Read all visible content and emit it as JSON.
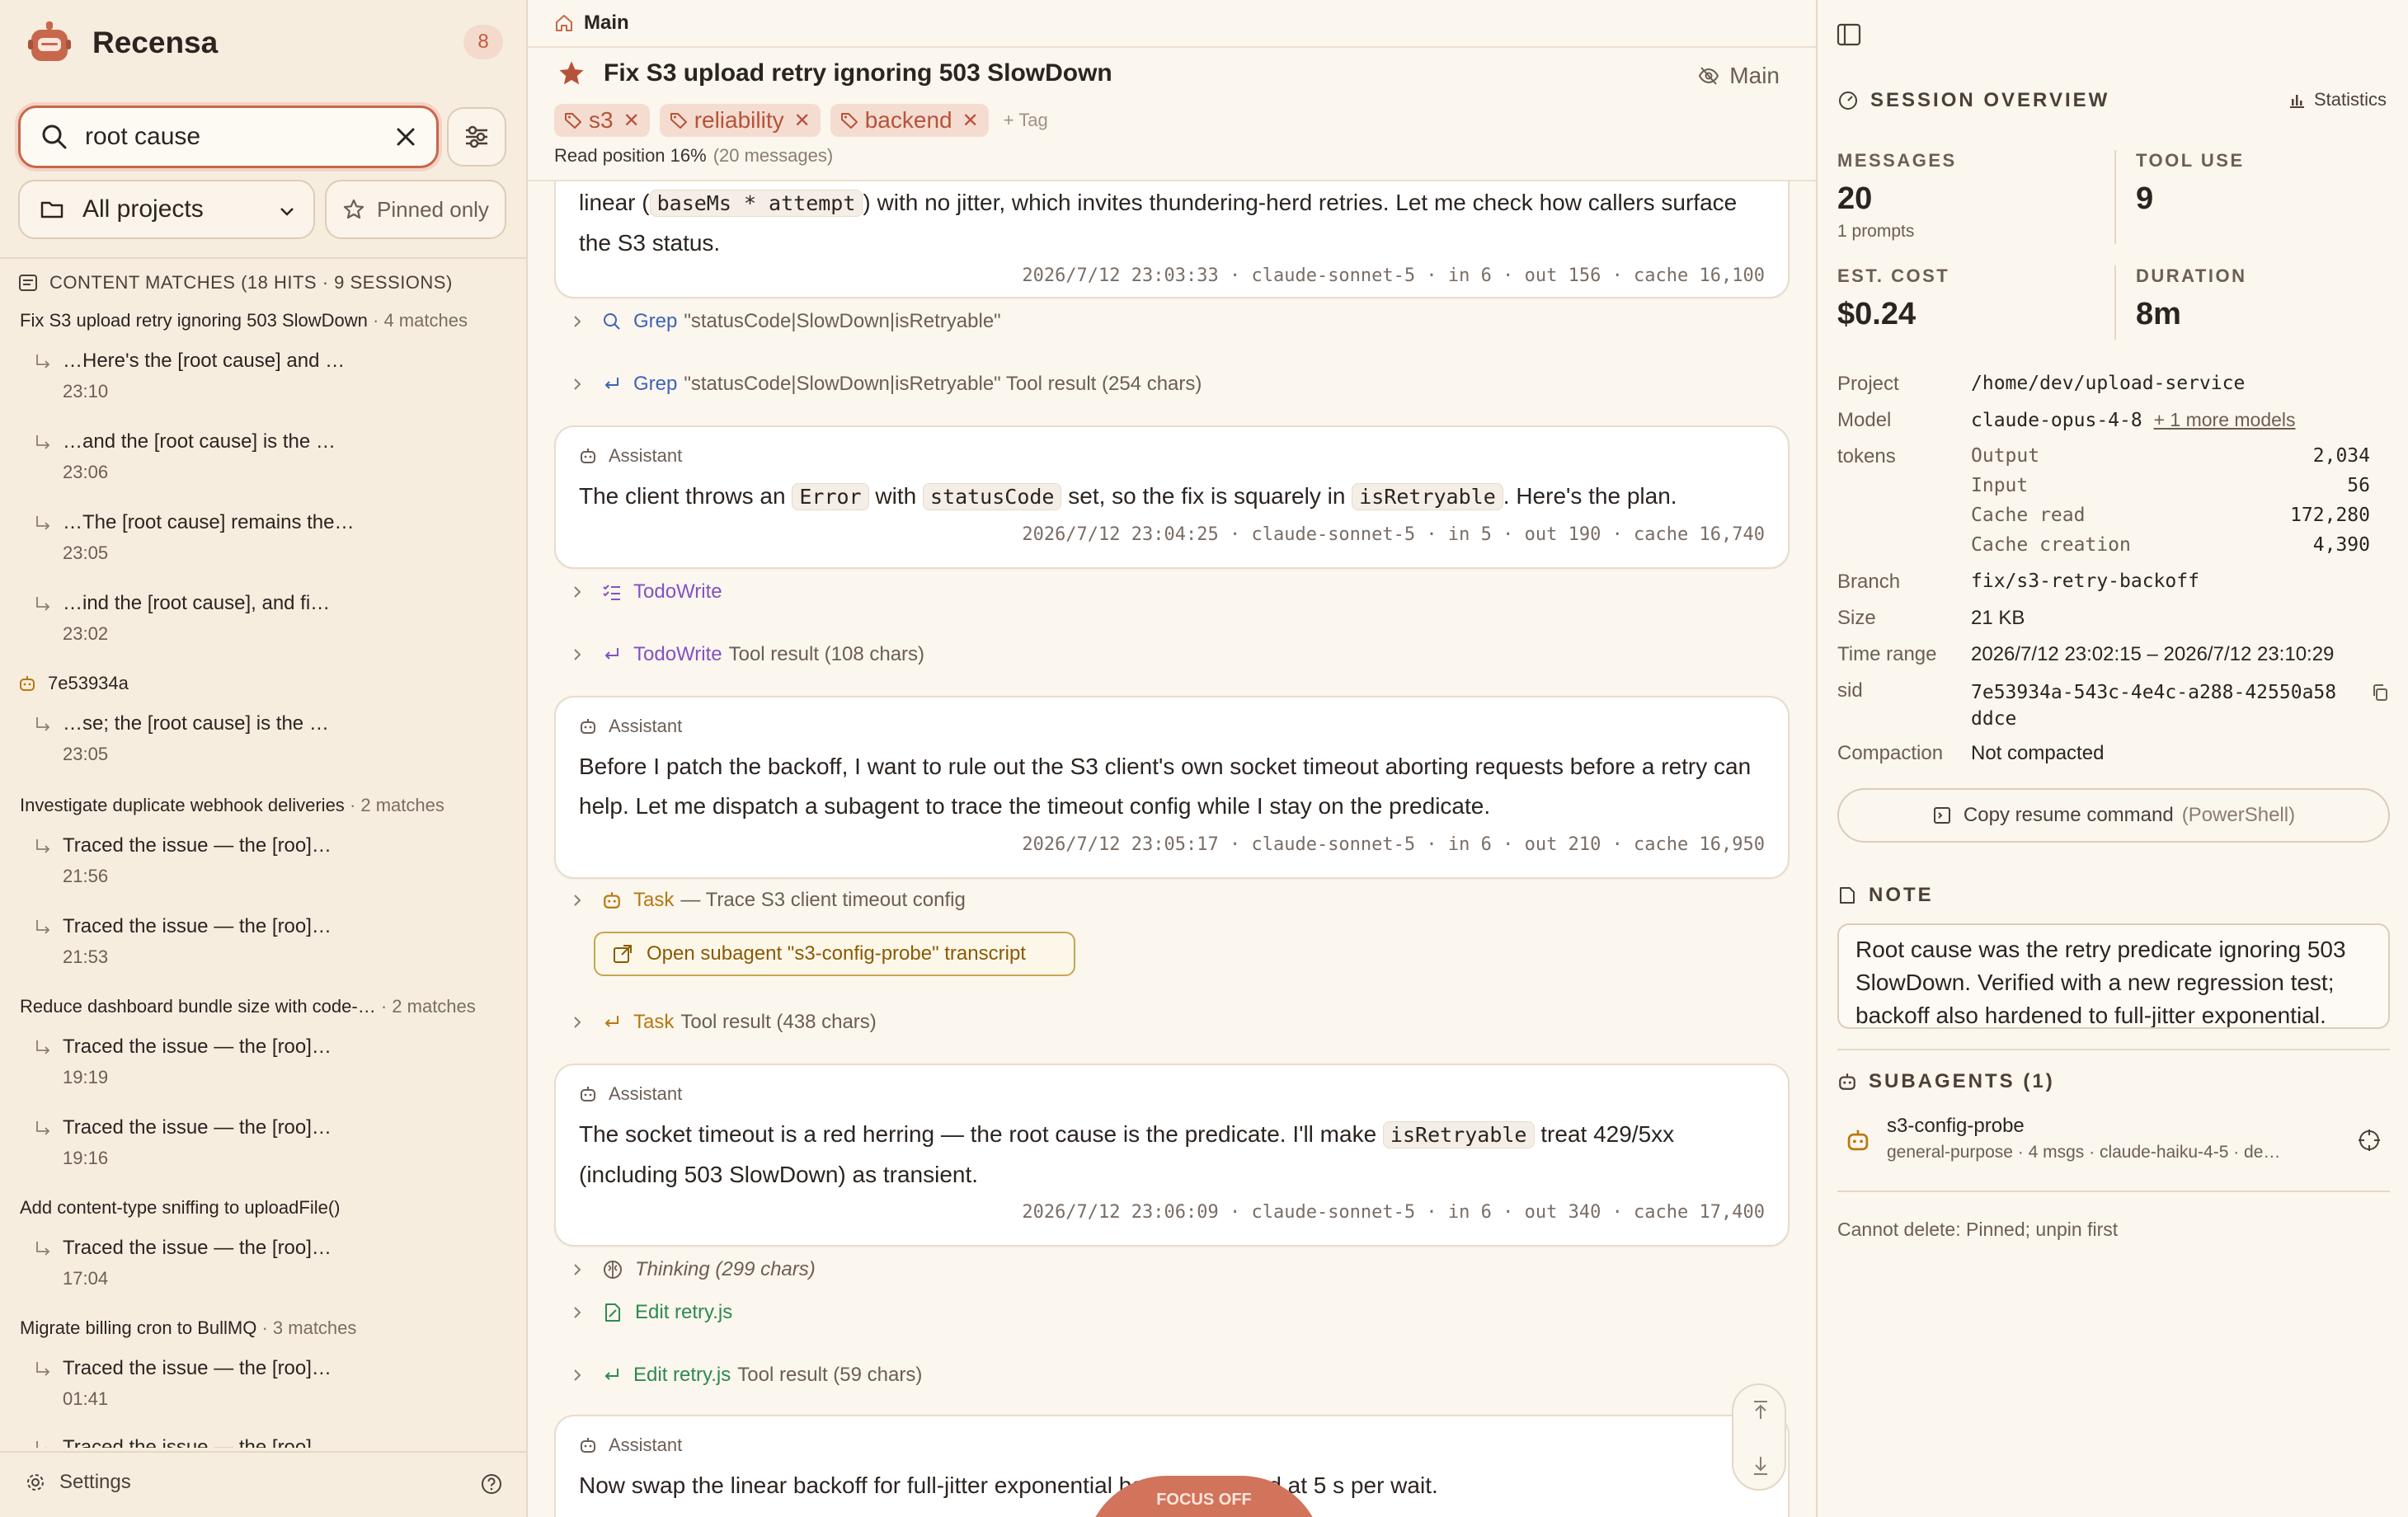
{
  "app": {
    "name": "Recensa",
    "badge_count": "8"
  },
  "sidebar": {
    "search_value": "root cause",
    "project_filter": "All projects",
    "pinned_only_label": "Pinned only",
    "matches_header": "CONTENT MATCHES (18 HITS · 9 SESSIONS)",
    "groups": [
      {
        "title": "Fix S3 upload retry ignoring 503 SlowDown",
        "count": "· 4 matches",
        "hits": [
          {
            "text": "…Here's the [root cause] and …",
            "time": "23:10"
          },
          {
            "text": "…and the [root cause] is the …",
            "time": "23:06"
          },
          {
            "text": "…The [root cause] remains the…",
            "time": "23:05"
          },
          {
            "text": "…ind the [root cause], and fi…",
            "time": "23:02"
          }
        ]
      },
      {
        "title": "7e53934a",
        "count": "",
        "hits": [
          {
            "text": "…se; the [root cause] is the …",
            "time": "23:05"
          }
        ]
      },
      {
        "title": "Investigate duplicate webhook deliveries",
        "count": "· 2 matches",
        "hits": [
          {
            "text": "Traced the issue — the [roo]…",
            "time": "21:56"
          },
          {
            "text": "Traced the issue — the [roo]…",
            "time": "21:53"
          }
        ]
      },
      {
        "title": "Reduce dashboard bundle size with code-…",
        "count": "· 2 matches",
        "hits": [
          {
            "text": "Traced the issue — the [roo]…",
            "time": "19:19"
          },
          {
            "text": "Traced the issue — the [roo]…",
            "time": "19:16"
          }
        ]
      },
      {
        "title": "Add content-type sniffing to uploadFile()",
        "count": "",
        "hits": [
          {
            "text": "Traced the issue — the [roo]…",
            "time": "17:04"
          }
        ]
      },
      {
        "title": "Migrate billing cron to BullMQ",
        "count": "· 3 matches",
        "hits": [
          {
            "text": "Traced the issue — the [roo]…",
            "time": "01:41"
          },
          {
            "text": "Traced the issue — the [roo]…",
            "time": ""
          }
        ]
      }
    ],
    "settings_label": "Settings"
  },
  "main": {
    "breadcrumb": "Main",
    "title": "Fix S3 upload retry ignoring 503 SlowDown",
    "branch_label": "Main",
    "tags": [
      "s3",
      "reliability",
      "backend"
    ],
    "add_tag_label": "+ Tag",
    "read_position": "Read position 16%",
    "read_position_sub": "(20 messages)",
    "messages": [
      {
        "role": "",
        "prefix": "linear (",
        "code": "baseMs * attempt",
        "suffix": ") with no jitter, which invites thundering-herd retries. Let me check how callers surface the S3 status.",
        "meta": "2026/7/12 23:03:33 · claude-sonnet-5 · in 6 · out 156 · cache 16,100"
      },
      {
        "role": "Assistant",
        "text1": "The client throws an ",
        "code1": "Error",
        "text2": " with ",
        "code2": "statusCode",
        "text3": " set, so the fix is squarely in ",
        "code3": "isRetryable",
        "text4": ". Here's the plan.",
        "meta": "2026/7/12 23:04:25 · claude-sonnet-5 · in 5 · out 190 · cache 16,740"
      },
      {
        "role": "Assistant",
        "text": "Before I patch the backoff, I want to rule out the S3 client's own socket timeout aborting requests before a retry can help. Let me dispatch a subagent to trace the timeout config while I stay on the predicate.",
        "meta": "2026/7/12 23:05:17 · claude-sonnet-5 · in 6 · out 210 · cache 16,950"
      },
      {
        "role": "Assistant",
        "text1": "The socket timeout is a red herring — the root cause is the predicate. I'll make ",
        "code1": "isRetryable",
        "text2": " treat 429/5xx (including 503 SlowDown) as transient.",
        "meta": "2026/7/12 23:06:09 · claude-sonnet-5 · in 6 · out 340 · cache 17,400"
      },
      {
        "role": "Assistant",
        "text": "Now swap the linear backoff for full-jitter exponential backoff, capped at 5 s per wait.",
        "meta": ""
      }
    ],
    "tools": [
      {
        "name": "Grep",
        "rest": "\"statusCode|SlowDown|isRetryable\""
      },
      {
        "name": "Grep",
        "rest": "\"statusCode|SlowDown|isRetryable\" Tool result (254 chars)"
      },
      {
        "name": "TodoWrite",
        "rest": ""
      },
      {
        "name": "TodoWrite",
        "rest": "Tool result (108 chars)"
      },
      {
        "name": "Task",
        "rest": "— Trace S3 client timeout config"
      },
      {
        "name": "Task",
        "rest": "Tool result (438 chars)"
      },
      {
        "name": "Thinking (299 chars)",
        "rest": ""
      },
      {
        "name": "Edit retry.js",
        "rest": ""
      },
      {
        "name": "Edit retry.js",
        "rest": "Tool result (59 chars)"
      }
    ],
    "subagent_link": "Open subagent \"s3-config-probe\" transcript",
    "focus_label": "FOCUS OFF"
  },
  "panel": {
    "overview_title": "SESSION OVERVIEW",
    "statistics_label": "Statistics",
    "kpis": {
      "messages_label": "MESSAGES",
      "messages_value": "20",
      "messages_sub": "1 prompts",
      "tool_use_label": "TOOL USE",
      "tool_use_value": "9",
      "cost_label": "EST. COST",
      "cost_value": "$0.24",
      "duration_label": "DURATION",
      "duration_value": "8m"
    },
    "details": {
      "project_label": "Project",
      "project": "/home/dev/upload-service",
      "model_label": "Model",
      "model": "claude-opus-4-8",
      "model_more": "+ 1 more models",
      "tokens_label": "tokens",
      "tokens": [
        {
          "k": "Output",
          "v": "2,034"
        },
        {
          "k": "Input",
          "v": "56"
        },
        {
          "k": "Cache read",
          "v": "172,280"
        },
        {
          "k": "Cache creation",
          "v": "4,390"
        }
      ],
      "branch_label": "Branch",
      "branch": "fix/s3-retry-backoff",
      "size_label": "Size",
      "size": "21 KB",
      "time_label": "Time range",
      "time": "2026/7/12 23:02:15 – 2026/7/12 23:10:29",
      "sid_label": "sid",
      "sid_line1": "7e53934a-543c-4e4c-a288-42550a58",
      "sid_line2": "ddce",
      "compaction_label": "Compaction",
      "compaction": "Not compacted"
    },
    "copy_resume_label": "Copy resume command",
    "copy_resume_sub": "(PowerShell)",
    "note_title": "NOTE",
    "note_text": "Root cause was the retry predicate ignoring 503 SlowDown. Verified with a new regression test; backoff also hardened to full-jitter exponential.",
    "subagents_title": "SUBAGENTS (1)",
    "subagent_name": "s3-config-probe",
    "subagent_desc": "general-purpose · 4 msgs · claude-haiku-4-5 · de…",
    "delete_warning": "Cannot delete: Pinned; unpin first"
  },
  "colors": {
    "accent": "#c7674b",
    "tag_bg": "#f5dcd0",
    "grep": "#3e63b8",
    "todo": "#8351c4",
    "task": "#b9770f",
    "edit": "#2d8a4e"
  }
}
